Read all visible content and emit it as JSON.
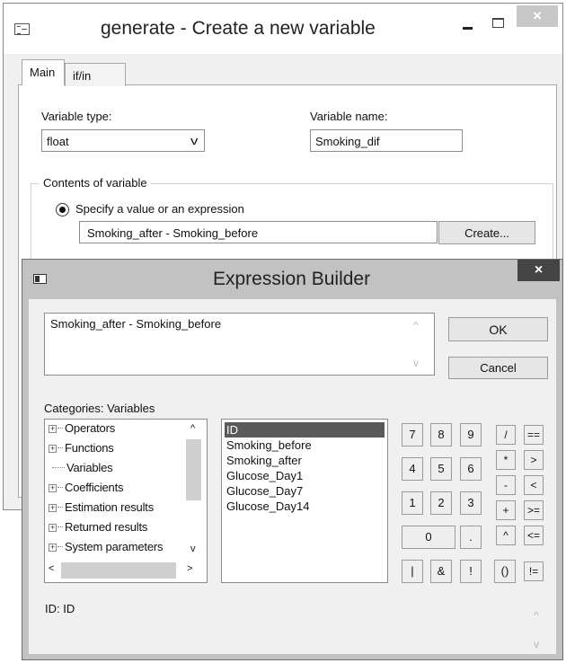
{
  "generate_window": {
    "title": "generate - Create a new variable",
    "tabs": [
      {
        "label": "Main"
      },
      {
        "label": "if/in"
      }
    ],
    "variable_type": {
      "label": "Variable type:",
      "value": "float"
    },
    "variable_name": {
      "label": "Variable name:",
      "value": "Smoking_dif"
    },
    "contents_group": {
      "legend": "Contents of variable",
      "radio_label": "Specify a value or an expression",
      "expression_value": "Smoking_after - Smoking_before",
      "create_button": "Create..."
    },
    "close_glyph": "×"
  },
  "expression_builder": {
    "title": "Expression Builder",
    "close_glyph": "×",
    "expression": "Smoking_after - Smoking_before",
    "ok_button": "OK",
    "cancel_button": "Cancel",
    "categories_label": "Categories: Variables",
    "tree_items": [
      {
        "label": "Operators",
        "expandable": true
      },
      {
        "label": "Functions",
        "expandable": true
      },
      {
        "label": "Variables",
        "expandable": false
      },
      {
        "label": "Coefficients",
        "expandable": true
      },
      {
        "label": "Estimation results",
        "expandable": true
      },
      {
        "label": "Returned results",
        "expandable": true
      },
      {
        "label": "System parameters",
        "expandable": true
      }
    ],
    "variables": [
      {
        "label": "ID",
        "selected": true
      },
      {
        "label": "Smoking_before",
        "selected": false
      },
      {
        "label": "Smoking_after",
        "selected": false
      },
      {
        "label": "Glucose_Day1",
        "selected": false
      },
      {
        "label": "Glucose_Day7",
        "selected": false
      },
      {
        "label": "Glucose_Day14",
        "selected": false
      }
    ],
    "keypad": {
      "digits": [
        "7",
        "8",
        "9",
        "4",
        "5",
        "6",
        "1",
        "2",
        "3",
        "0",
        "."
      ],
      "logic": [
        "|",
        "&",
        "!",
        "()"
      ],
      "operators": [
        "/",
        "==",
        "*",
        ">",
        "-",
        "<",
        "+",
        ">=",
        "^",
        "<=",
        "!="
      ]
    },
    "status_text": "ID:  ID"
  },
  "colors": {
    "selection": "#5a5a5a",
    "dialog_background": "#f0f0f0",
    "active_close": "#444444"
  }
}
